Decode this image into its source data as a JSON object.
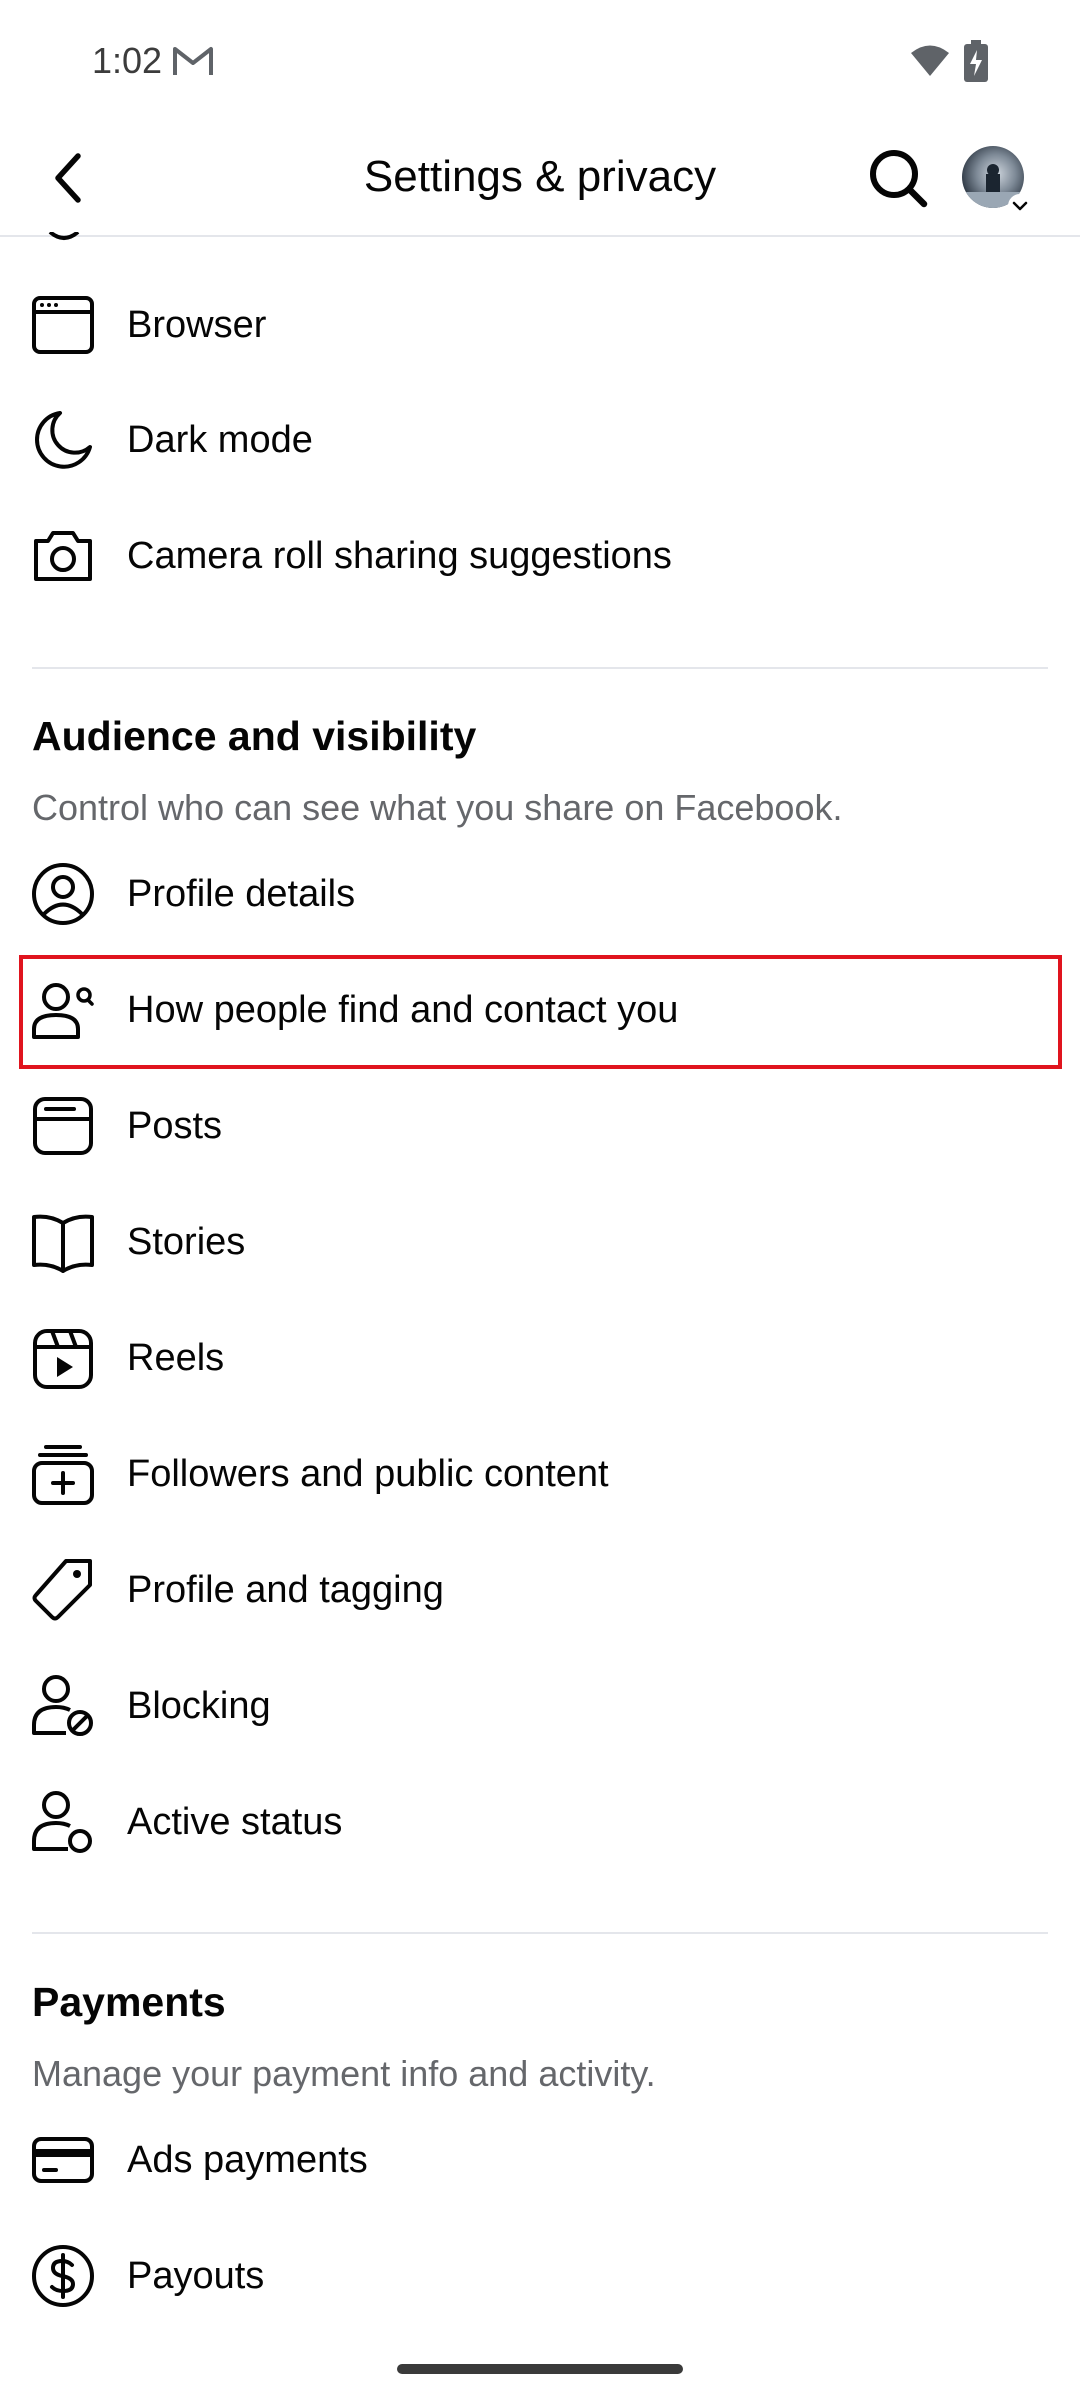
{
  "status_bar": {
    "time": "1:02"
  },
  "header": {
    "title": "Settings & privacy"
  },
  "top_items": [
    {
      "label": "Browser",
      "icon": "browser-icon"
    },
    {
      "label": "Dark mode",
      "icon": "moon-icon"
    },
    {
      "label": "Camera roll sharing suggestions",
      "icon": "camera-icon"
    }
  ],
  "audience": {
    "title": "Audience and visibility",
    "description": "Control who can see what you share on Facebook.",
    "items": [
      {
        "label": "Profile details",
        "icon": "profile-circle-icon"
      },
      {
        "label": "How people find and contact you",
        "icon": "person-search-icon",
        "highlighted": true
      },
      {
        "label": "Posts",
        "icon": "posts-icon"
      },
      {
        "label": "Stories",
        "icon": "book-icon"
      },
      {
        "label": "Reels",
        "icon": "reels-icon"
      },
      {
        "label": "Followers and public content",
        "icon": "followers-icon"
      },
      {
        "label": "Profile and tagging",
        "icon": "tag-icon"
      },
      {
        "label": "Blocking",
        "icon": "person-block-icon"
      },
      {
        "label": "Active status",
        "icon": "person-status-icon"
      }
    ]
  },
  "payments": {
    "title": "Payments",
    "description": "Manage your payment info and activity.",
    "items": [
      {
        "label": "Ads payments",
        "icon": "card-icon"
      },
      {
        "label": "Payouts",
        "icon": "dollar-icon"
      }
    ]
  },
  "colors": {
    "highlight_border": "#e0141e",
    "divider": "#e4e6eb",
    "secondary_text": "#65676b"
  }
}
